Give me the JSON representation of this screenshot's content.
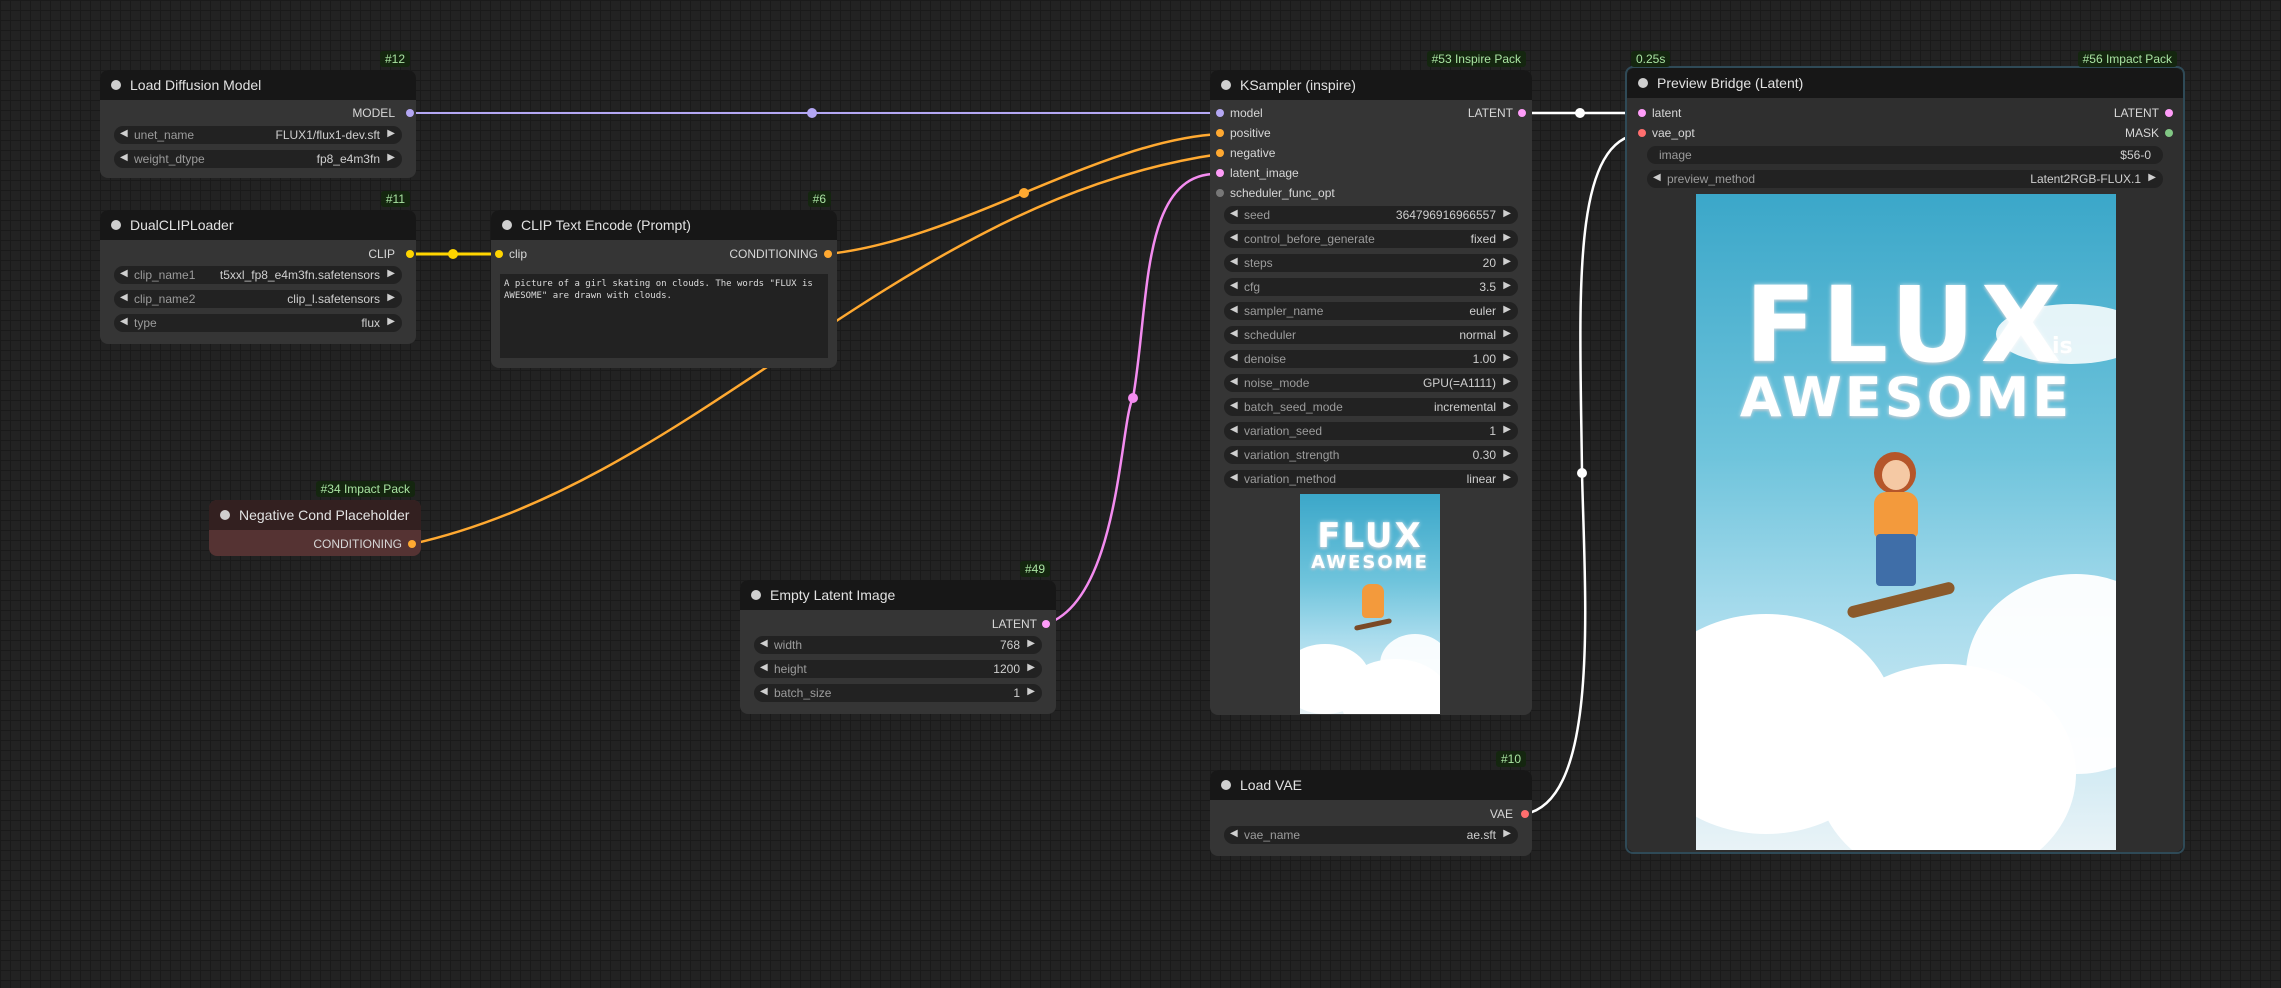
{
  "colors": {
    "model": "#b4a7f4",
    "clip": "#ffd500",
    "conditioning": "#ffa931",
    "latent": "#ff9cf9",
    "vae": "#ff6e6e",
    "mask": "#81c784",
    "background": "#222222",
    "node": "#353535",
    "header": "#171717",
    "badge_text": "#a9e3a2"
  },
  "nodes": {
    "load_diffusion": {
      "id": "#12",
      "title": "Load Diffusion Model",
      "output": "MODEL",
      "widgets": [
        {
          "label": "unet_name",
          "value": "FLUX1/flux1-dev.sft"
        },
        {
          "label": "weight_dtype",
          "value": "fp8_e4m3fn"
        }
      ]
    },
    "dualclip": {
      "id": "#11",
      "title": "DualCLIPLoader",
      "output": "CLIP",
      "widgets": [
        {
          "label": "clip_name1",
          "value": "t5xxl_fp8_e4m3fn.safetensors"
        },
        {
          "label": "clip_name2",
          "value": "clip_l.safetensors"
        },
        {
          "label": "type",
          "value": "flux"
        }
      ]
    },
    "clip_text": {
      "id": "#6",
      "title": "CLIP Text Encode (Prompt)",
      "input": "clip",
      "output": "CONDITIONING",
      "text": "A picture of a girl skating on clouds. The words \"FLUX is AWESOME\" are drawn with clouds."
    },
    "neg_cond": {
      "id": "#34 Impact Pack",
      "title": "Negative Cond Placeholder",
      "output": "CONDITIONING"
    },
    "empty_latent": {
      "id": "#49",
      "title": "Empty Latent Image",
      "output": "LATENT",
      "widgets": [
        {
          "label": "width",
          "value": "768"
        },
        {
          "label": "height",
          "value": "1200"
        },
        {
          "label": "batch_size",
          "value": "1"
        }
      ]
    },
    "ksampler": {
      "id": "#53 Inspire Pack",
      "title": "KSampler (inspire)",
      "output": "LATENT",
      "inputs": [
        "model",
        "positive",
        "negative",
        "latent_image",
        "scheduler_func_opt"
      ],
      "widgets": [
        {
          "label": "seed",
          "value": "364796916966557"
        },
        {
          "label": "control_before_generate",
          "value": "fixed"
        },
        {
          "label": "steps",
          "value": "20"
        },
        {
          "label": "cfg",
          "value": "3.5"
        },
        {
          "label": "sampler_name",
          "value": "euler"
        },
        {
          "label": "scheduler",
          "value": "normal"
        },
        {
          "label": "denoise",
          "value": "1.00"
        },
        {
          "label": "noise_mode",
          "value": "GPU(=A1111)"
        },
        {
          "label": "batch_seed_mode",
          "value": "incremental"
        },
        {
          "label": "variation_seed",
          "value": "1"
        },
        {
          "label": "variation_strength",
          "value": "0.30"
        },
        {
          "label": "variation_method",
          "value": "linear"
        }
      ],
      "preview_text": [
        "FLUX",
        "AWESOME"
      ]
    },
    "load_vae": {
      "id": "#10",
      "title": "Load VAE",
      "output": "VAE",
      "widgets": [
        {
          "label": "vae_name",
          "value": "ae.sft"
        }
      ]
    },
    "preview_bridge": {
      "id": "#56 Impact Pack",
      "time": "0.25s",
      "title": "Preview Bridge (Latent)",
      "inputs": [
        "latent",
        "vae_opt"
      ],
      "outputs": [
        "LATENT",
        "MASK"
      ],
      "widgets": [
        {
          "label": "image",
          "value": "$56-0"
        },
        {
          "label": "preview_method",
          "value": "Latent2RGB-FLUX.1"
        }
      ],
      "preview_text": [
        "FLUX",
        "is",
        "AWESOME"
      ]
    }
  },
  "icons": {
    "arrow_left": "◀",
    "arrow_right": "▶"
  }
}
